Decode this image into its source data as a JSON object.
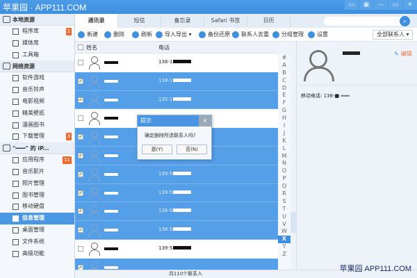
{
  "watermark_top": "苹果园 · APP111.COM",
  "watermark_bottom": "苹果园 APP111.COM",
  "window_buttons": [
    "feedback",
    "skin",
    "minimize",
    "maximize",
    "close"
  ],
  "sidebar": {
    "sections": [
      {
        "title": "本地资源",
        "items": [
          {
            "label": "程序库",
            "badge": "2"
          },
          {
            "label": "媒体库"
          },
          {
            "label": "工具箱"
          }
        ]
      },
      {
        "title": "网络资源",
        "items": [
          {
            "label": "软件游戏"
          },
          {
            "label": "音乐铃声"
          },
          {
            "label": "电影视频"
          },
          {
            "label": "精美壁纸"
          },
          {
            "label": "漫画图书"
          },
          {
            "label": "下载管理",
            "badge": "3"
          }
        ]
      },
      {
        "title": "\"━━━\" 的 iP...",
        "items": [
          {
            "label": "应用程序",
            "badge": "11"
          },
          {
            "label": "音乐影片"
          },
          {
            "label": "照片管理"
          },
          {
            "label": "图书管理"
          },
          {
            "label": "移动硬盘"
          },
          {
            "label": "信息管理",
            "active": true
          },
          {
            "label": "桌面管理"
          },
          {
            "label": "文件系统"
          },
          {
            "label": "高级功能"
          }
        ]
      }
    ]
  },
  "tabs": [
    "通讯录",
    "短信",
    "备忘录",
    "Safari 书签",
    "日历"
  ],
  "search": {
    "placeholder": ""
  },
  "toolbar": {
    "new": "新建",
    "delete": "删除",
    "refresh": "刷新",
    "import_export": "导入导出 ▾",
    "backup": "备份还原 ▾",
    "dedupe": "联系人去重",
    "groups": "分组管理",
    "settings": "设置",
    "filter": "全部联系人"
  },
  "columns": {
    "name": "姓名",
    "phone": "电话"
  },
  "rows": [
    {
      "phone": "138-1",
      "checked": false
    },
    {
      "phone": "138-1",
      "checked": true
    },
    {
      "phone": "135-1",
      "checked": true
    },
    {
      "phone": "",
      "checked": false
    },
    {
      "phone": "",
      "checked": true
    },
    {
      "phone": "",
      "checked": true
    },
    {
      "phone": "139-5",
      "checked": true
    },
    {
      "phone": "139-5",
      "checked": true
    },
    {
      "phone": "136-0",
      "checked": true
    },
    {
      "phone": "138-5",
      "checked": true
    },
    {
      "phone": "139-5",
      "checked": false
    },
    {
      "phone": "",
      "checked": true
    }
  ],
  "index": [
    "#",
    "A",
    "B",
    "C",
    "D",
    "E",
    "F",
    "G",
    "H",
    "I",
    "J",
    "K",
    "L",
    "M",
    "N",
    "O",
    "P",
    "Q",
    "R",
    "S",
    "T",
    "U",
    "V",
    "W",
    "X",
    "Y",
    "Z"
  ],
  "index_active": "X",
  "detail": {
    "edit": "编辑",
    "mobile": "移动电话: 138-■ ═══"
  },
  "footer": {
    "count": "共110个联系人"
  },
  "dialog": {
    "title": "提示",
    "message": "确定删除所选联系人吗?",
    "yes": "是(Y)",
    "no": "否(N)",
    "close": "×"
  }
}
